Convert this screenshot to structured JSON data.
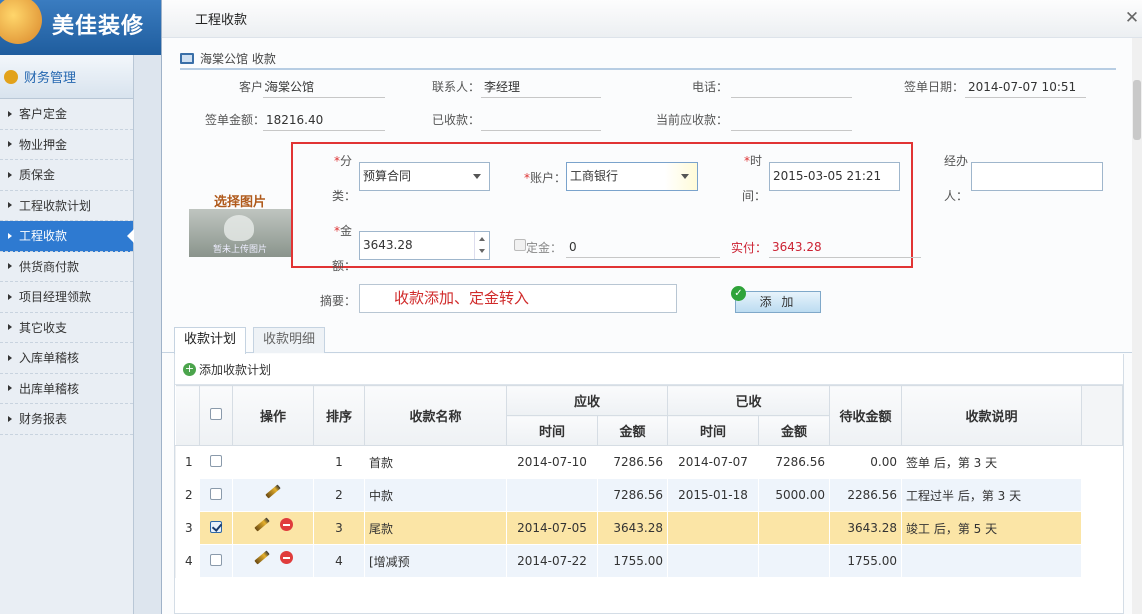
{
  "app": {
    "logo_text": "美佳装修"
  },
  "sidebar": {
    "header": "财务管理",
    "items": [
      {
        "label": "客户定金"
      },
      {
        "label": "物业押金"
      },
      {
        "label": "质保金"
      },
      {
        "label": "工程收款计划"
      },
      {
        "label": "工程收款",
        "active": true
      },
      {
        "label": "供货商付款"
      },
      {
        "label": "项目经理领款"
      },
      {
        "label": "其它收支"
      },
      {
        "label": "入库单稽核"
      },
      {
        "label": "出库单稽核"
      },
      {
        "label": "财务报表"
      }
    ]
  },
  "dialog": {
    "title": "工程收款",
    "close_icon": "close-icon",
    "section_title": "海棠公馆 收款",
    "info": {
      "customer_label": "客户：",
      "customer_value": "海棠公馆",
      "contact_label": "联系人：",
      "contact_value": "李经理",
      "phone_label": "电话：",
      "phone_value": "",
      "sign_date_label": "签单日期：",
      "sign_date_value": "2014-07-07 10:51",
      "sign_amount_label": "签单金额：",
      "sign_amount_value": "18216.40",
      "received_label": "已收款：",
      "received_value": "",
      "current_due_label": "当前应收款：",
      "current_due_value": ""
    },
    "form": {
      "required_mark": "*",
      "category_label_1": "分",
      "category_label_2": "类：",
      "category_value": "预算合同",
      "account_label": "账户：",
      "account_value": "工商银行",
      "time_label_1": "时",
      "time_label_2": "间：",
      "time_value": "2015-03-05 21:21",
      "handler_label_1": "经办",
      "handler_label_2": "人：",
      "handler_value": "",
      "amount_label_1": "金",
      "amount_label_2": "额：",
      "amount_value": "3643.28",
      "deposit_label": "定金：",
      "deposit_value": "0",
      "actual_label": "实付：",
      "actual_value": "3643.28",
      "remark_label": "摘要：",
      "remark_value": "收款添加、定金转入",
      "image_title": "选择图片",
      "image_caption": "暂未上传图片",
      "add_button": "添 加"
    },
    "tabs": [
      {
        "label": "收款计划",
        "active": true
      },
      {
        "label": "收款明细"
      }
    ],
    "grid": {
      "add_plan_label": "添加收款计划",
      "headers": {
        "ops": "操作",
        "order": "排序",
        "name": "收款名称",
        "due": "应收",
        "received": "已收",
        "time": "时间",
        "amount": "金额",
        "pending": "待收金额",
        "desc": "收款说明"
      },
      "rows": [
        {
          "no": "1",
          "checked": false,
          "edit": false,
          "del": false,
          "order": "1",
          "name": "首款",
          "due_time": "2014-07-10",
          "due_amount": "7286.56",
          "rec_time": "2014-07-07",
          "rec_amount": "7286.56",
          "pending": "0.00",
          "desc": "签单 后，第 3 天"
        },
        {
          "no": "2",
          "checked": false,
          "edit": true,
          "del": false,
          "order": "2",
          "name": "中款",
          "due_time": "",
          "due_amount": "7286.56",
          "rec_time": "2015-01-18",
          "rec_amount": "5000.00",
          "pending": "2286.56",
          "desc": "工程过半 后，第 3 天"
        },
        {
          "no": "3",
          "checked": true,
          "edit": true,
          "del": true,
          "order": "3",
          "name": "尾款",
          "due_time": "2014-07-05",
          "due_amount": "3643.28",
          "rec_time": "",
          "rec_amount": "",
          "pending": "3643.28",
          "desc": "竣工 后，第 5 天"
        },
        {
          "no": "4",
          "checked": false,
          "edit": true,
          "del": true,
          "order": "4",
          "name": "[增减预",
          "due_time": "2014-07-22",
          "due_amount": "1755.00",
          "rec_time": "",
          "rec_amount": "",
          "pending": "1755.00",
          "desc": ""
        }
      ]
    }
  },
  "colors": {
    "accent": "#2e7ad1",
    "required": "#d33333",
    "highlight_box": "#e13434",
    "selected_row": "#fbe5a6"
  }
}
